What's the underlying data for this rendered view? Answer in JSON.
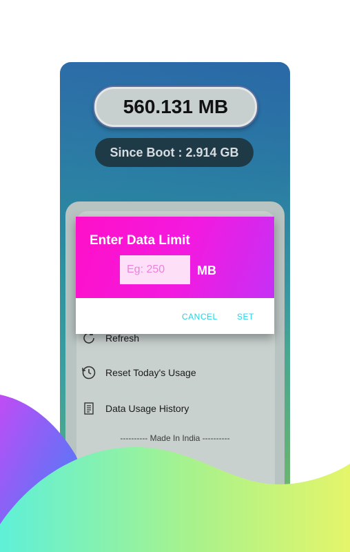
{
  "usage": {
    "today": "560.131 MB",
    "since_boot": "Since Boot : 2.914 GB"
  },
  "menu": [
    {
      "label": "Refresh",
      "icon": "refresh-icon"
    },
    {
      "label": "Reset Today's Usage",
      "icon": "history-clock-icon"
    },
    {
      "label": "Data Usage History",
      "icon": "document-icon"
    }
  ],
  "footer": {
    "made_in": "---------- Made In India ----------"
  },
  "dialog": {
    "title": "Enter Data Limit",
    "input_placeholder": "Eg: 250",
    "input_value": "",
    "unit": "MB",
    "cancel_label": "CANCEL",
    "set_label": "SET"
  },
  "colors": {
    "dialog_gradient_start": "#ff10c8",
    "dialog_gradient_end": "#c630f5",
    "button_text": "#22d3e8"
  }
}
